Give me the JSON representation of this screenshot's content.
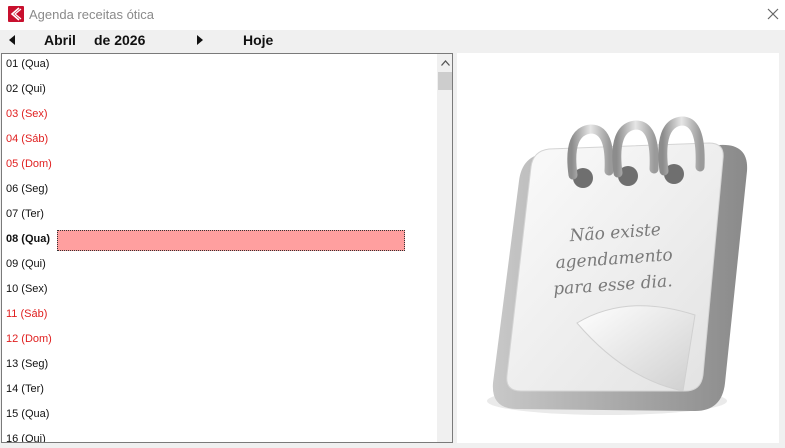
{
  "window": {
    "title": "Agenda receitas ótica",
    "icon": "app-logo-icon",
    "close_icon": "close-icon"
  },
  "nav": {
    "prev_icon": "arrow-left-icon",
    "month": "Abril",
    "year_label": "de 2026",
    "next_icon": "arrow-right-icon",
    "today_label": "Hoje"
  },
  "days": [
    {
      "label": "01 (Qua)",
      "weekend": false
    },
    {
      "label": "02 (Qui)",
      "weekend": false
    },
    {
      "label": "03 (Sex)",
      "weekend": true
    },
    {
      "label": "04 (Sáb)",
      "weekend": true
    },
    {
      "label": "05 (Dom)",
      "weekend": true
    },
    {
      "label": "06 (Seg)",
      "weekend": false
    },
    {
      "label": "07 (Ter)",
      "weekend": false
    },
    {
      "label": "08 (Qua)",
      "weekend": false,
      "today": true
    },
    {
      "label": "09 (Qui)",
      "weekend": false
    },
    {
      "label": "10 (Sex)",
      "weekend": false
    },
    {
      "label": "11 (Sáb)",
      "weekend": true
    },
    {
      "label": "12 (Dom)",
      "weekend": true
    },
    {
      "label": "13 (Seg)",
      "weekend": false
    },
    {
      "label": "14 (Ter)",
      "weekend": false
    },
    {
      "label": "15 (Qua)",
      "weekend": false
    },
    {
      "label": "16 (Qui)",
      "weekend": false
    }
  ],
  "empty_state": {
    "lines": [
      "Não existe",
      "agendamento",
      "para esse dia."
    ],
    "icon": "notepad-icon"
  },
  "colors": {
    "weekend_text": "#e02020",
    "today_highlight": "#ff9f9f",
    "brand": "#c8102e"
  }
}
